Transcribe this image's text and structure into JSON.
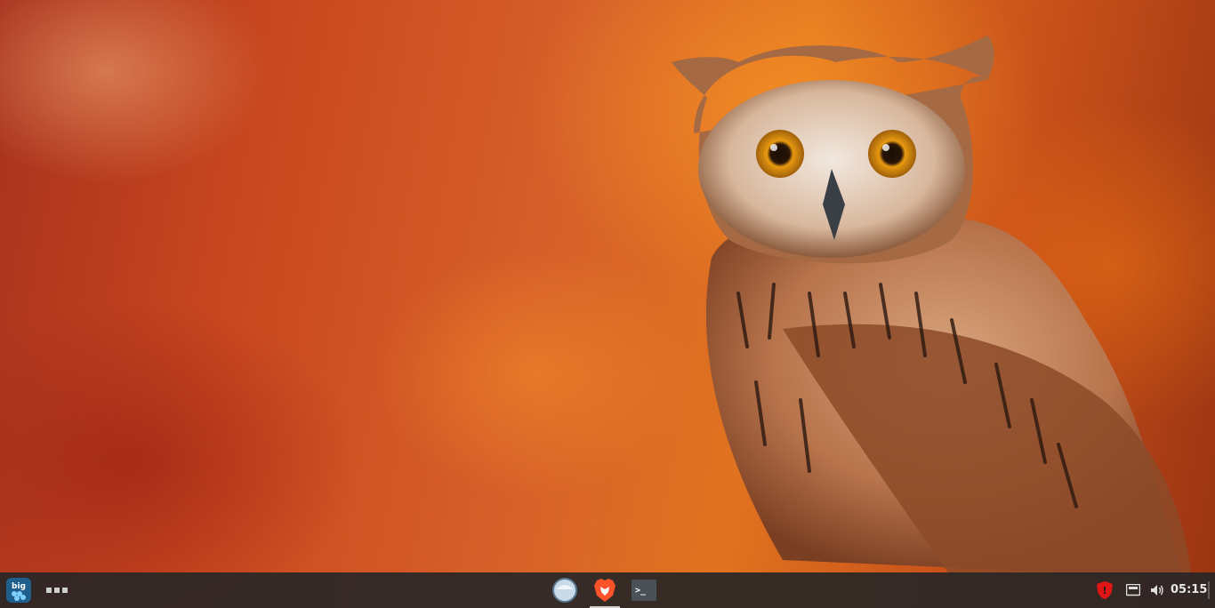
{
  "desktop": {
    "wallpaper": "owl-autumn-wallpaper",
    "accent_colors": [
      "#c9481f",
      "#e0731f",
      "#a8321e"
    ]
  },
  "taskbar": {
    "start_menu_icon": "biglinux-logo-icon",
    "start_menu_text": "big",
    "overflow_icon": "dots-icon",
    "apps": [
      {
        "name": "files",
        "icon": "file-manager-icon"
      },
      {
        "name": "brave",
        "icon": "brave-browser-icon",
        "active": true
      },
      {
        "name": "terminal",
        "icon": "terminal-icon",
        "label": ">_"
      }
    ],
    "tray": {
      "shield_icon": "security-shield-icon",
      "shield_mark": "!",
      "display_icon": "display-icon",
      "volume_icon": "volume-icon",
      "clock": "05:15"
    }
  }
}
